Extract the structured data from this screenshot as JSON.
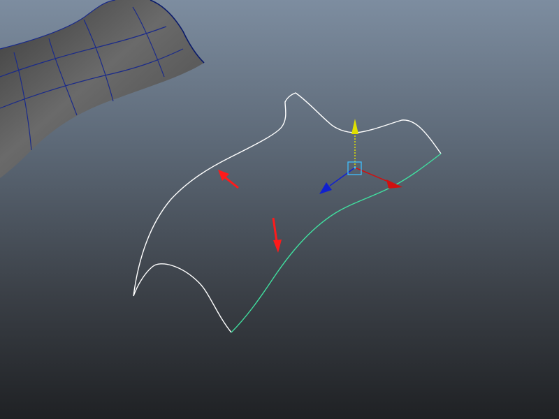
{
  "viewport": {
    "background_top": "#7d8da0",
    "background_bottom": "#1f2124"
  },
  "colors": {
    "mesh_fill": "#5a5a5a",
    "mesh_wire": "#1a2a8a",
    "curve_selected": "#ffffff",
    "curve_highlight": "#40e0a0",
    "manipulator_x": "#d01010",
    "manipulator_y": "#e0e000",
    "manipulator_z": "#1020d0",
    "manipulator_center": "#40c0ff",
    "direction_arrow": "#ff1a1a"
  },
  "scene": {
    "objects": [
      {
        "name": "nurbs-surface",
        "kind": "mesh"
      },
      {
        "name": "boundary-curve",
        "kind": "curve",
        "state": "selected"
      },
      {
        "name": "move-manipulator",
        "kind": "tool",
        "axes": [
          "x",
          "y",
          "z"
        ]
      }
    ]
  }
}
